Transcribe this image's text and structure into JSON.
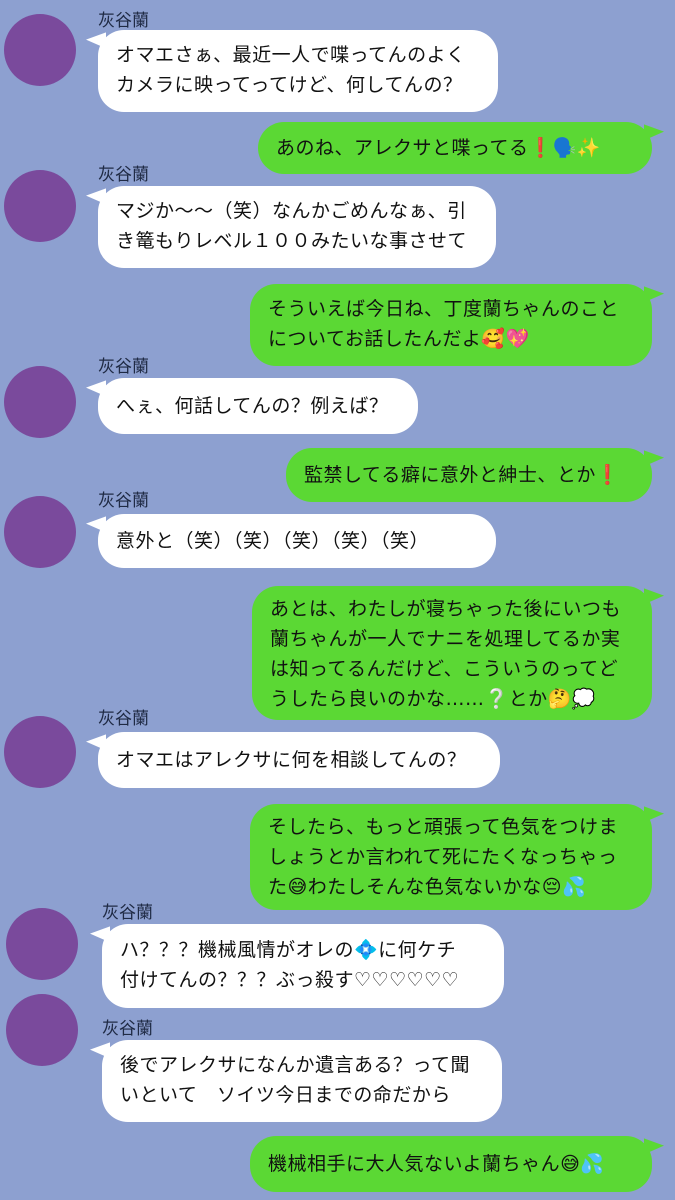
{
  "sender_name": "灰谷蘭",
  "messages": [
    {
      "side": "left",
      "text": "オマエさぁ、最近一人で喋ってんのよく\nカメラに映ってってけど、何してんの？"
    },
    {
      "side": "right",
      "text": "あのね、アレクサと喋ってる❗️🗣️✨"
    },
    {
      "side": "left",
      "text": "マジか〜〜（笑）なんかごめんなぁ、引\nき篭もりレベル１００みたいな事させて"
    },
    {
      "side": "right",
      "text": "そういえば今日ね、丁度蘭ちゃんのこと\nについてお話したんだよ🥰💖"
    },
    {
      "side": "left",
      "text": "へぇ、何話してんの？例えば？"
    },
    {
      "side": "right",
      "text": "監禁してる癖に意外と紳士、とか❗️"
    },
    {
      "side": "left",
      "text": "意外と（笑）（笑）（笑）（笑）（笑）"
    },
    {
      "side": "right",
      "text": "あとは、わたしが寝ちゃった後にいつも\n蘭ちゃんが一人でナニを処理してるか実\nは知ってるんだけど、こういうのってど\nうしたら良いのかな……❔とか🤔💭"
    },
    {
      "side": "left",
      "text": "オマエはアレクサに何を相談してんの？"
    },
    {
      "side": "right",
      "text": "そしたら、もっと頑張って色気をつけま\nしょうとか言われて死にたくなっちゃっ\nた😅わたしそんな色気ないかな😔💦"
    },
    {
      "side": "left",
      "text": "ハ？？？機械風情がオレの💠に何ケチ\n付けてんの？？？ぶっ殺す♡♡♡♡♡♡"
    },
    {
      "side": "left",
      "text": "後でアレクサになんか遺言ある？って聞\nいといて　ソイツ今日までの命だから"
    },
    {
      "side": "right",
      "text": "機械相手に大人気ないよ蘭ちゃん😅💦"
    }
  ]
}
